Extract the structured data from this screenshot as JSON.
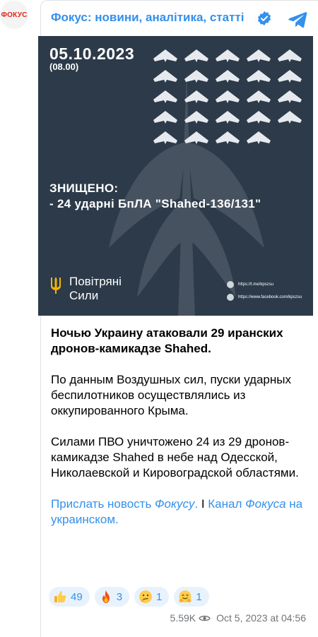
{
  "avatar": {
    "text": "ФОКУС"
  },
  "header": {
    "channel_name": "Фокус: новини, аналітика, статті",
    "verified_icon": "verified-badge-icon",
    "app_icon": "telegram-icon"
  },
  "media": {
    "date": "05.10.2023",
    "time": "(08.00)",
    "drone_count_shown": 24,
    "killed_line1": "ЗНИЩЕНО:",
    "killed_line2": "- 24 ударні БпЛА \"Shahed-136/131\"",
    "af_line1": "Повітряні",
    "af_line2": "Сили",
    "link1": "https://t.me/kpszsu",
    "link2": "https://www.facebook.com/kpszsu"
  },
  "post": {
    "headline": "Ночью Украину атаковали 29 иранских дронов-камикадзе Shahed.",
    "p1": "По данным Воздушных сил, пуски ударных беспилотников осуществлялись из оккупированного Крыма.",
    "p2": "Силами ПВО уничтожено 24 из 29 дронов-камикадзе Shahed в небе над Одесской, Николаевской и Кировоградской областями.",
    "link_a_pre": "Прислать новость ",
    "link_a_it": "Фокусу",
    "link_a_post": ".",
    "separator": " I ",
    "link_b_pre": "Канал ",
    "link_b_it": "Фокуса",
    "link_b_post": " на украинском."
  },
  "reactions": [
    {
      "icon": "thumbs-up-icon",
      "count": "49"
    },
    {
      "icon": "fire-icon",
      "count": "3"
    },
    {
      "icon": "hmm-face-icon",
      "count": "1"
    },
    {
      "icon": "hug-face-icon",
      "count": "1"
    }
  ],
  "meta": {
    "views": "5.59K",
    "timestamp": "Oct 5, 2023 at 04:56"
  },
  "colors": {
    "accent": "#3390ec",
    "media_bg": "#2c3a49",
    "logo_red": "#e2231a"
  }
}
